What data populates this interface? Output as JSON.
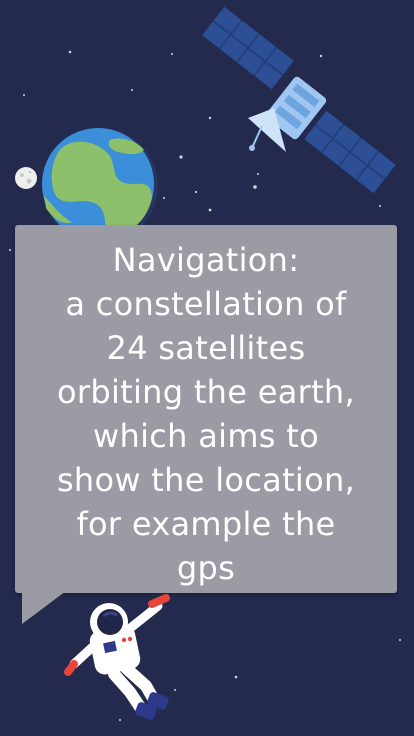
{
  "slide": {
    "title": "Navigation:",
    "lines": [
      "a constellation of",
      "24 satellites",
      "orbiting the earth,",
      "which aims to",
      "show the location,",
      "for example the",
      "gps"
    ]
  },
  "colors": {
    "background": "#232a4d",
    "bubble": "#9a9ba4",
    "ocean": "#3a8fd8",
    "land": "#8cc06a",
    "satellite_panel": "#2c4f95",
    "satellite_body": "#9fc7f2",
    "astronaut_suit": "#ffffff",
    "astronaut_accent": "#e9443b",
    "astronaut_boots": "#2d3a8c"
  },
  "icons": {
    "satellite": "satellite-icon",
    "earth": "earth-icon",
    "moon": "moon-icon",
    "astronaut": "astronaut-icon"
  }
}
